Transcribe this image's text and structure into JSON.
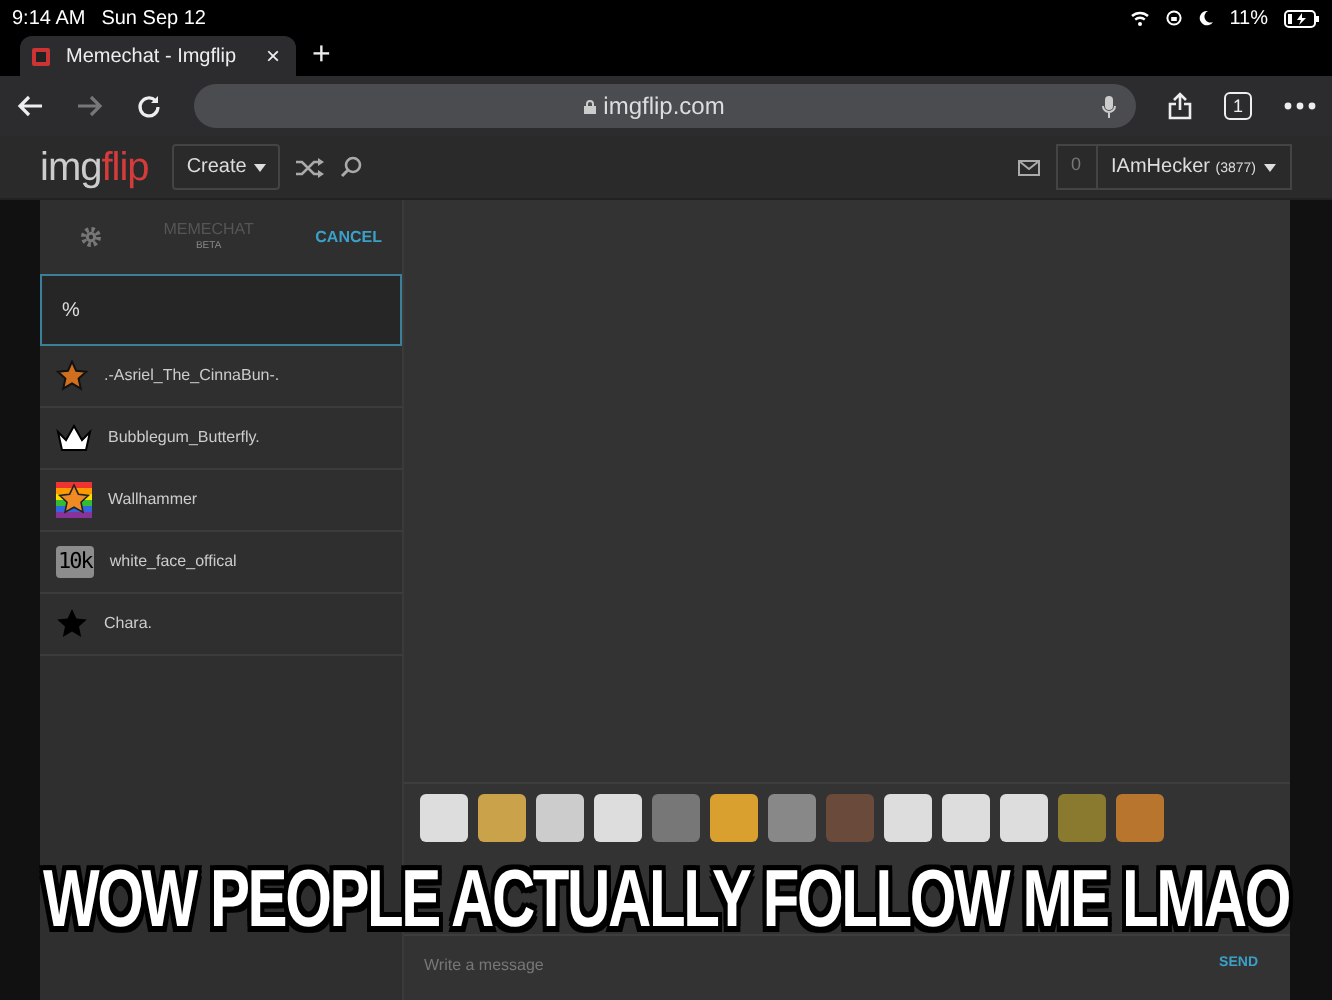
{
  "status_bar": {
    "time": "9:14 AM",
    "date": "Sun Sep 12",
    "battery": "11%"
  },
  "browser": {
    "tab_title": "Memechat - Imgflip",
    "tab_close": "×",
    "new_tab": "+",
    "url": "imgflip.com",
    "tab_count": "1"
  },
  "site_header": {
    "logo_parts": [
      "img",
      "flip"
    ],
    "create": "Create",
    "notification_count": "0",
    "username": "IAmHecker",
    "points": "(3877)"
  },
  "chat": {
    "title": "MEMECHAT",
    "subtitle": "BETA",
    "cancel": "CANCEL",
    "search_value": "%",
    "users": [
      {
        "name": ".-Asriel_The_CinnaBun-.",
        "kind": "bronze-star"
      },
      {
        "name": "Bubblegum_Butterfly.",
        "kind": "crown"
      },
      {
        "name": "Wallhammer",
        "kind": "rainbow-star"
      },
      {
        "name": "white_face_offical",
        "kind": "text",
        "badge": "10k"
      },
      {
        "name": "Chara.",
        "kind": "black-star"
      }
    ],
    "message_placeholder": "Write a message",
    "send": "SEND"
  },
  "caption": "WOW PEOPLE ACTUALLY FOLLOW ME LMAO"
}
